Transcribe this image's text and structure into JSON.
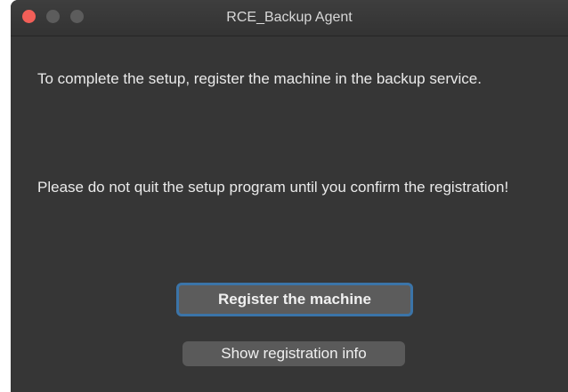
{
  "window": {
    "title": "RCE_Backup Agent"
  },
  "content": {
    "message_1": "To complete the setup, register the machine in the backup service.",
    "message_2": "Please do not quit the setup program until you confirm the registration!"
  },
  "buttons": {
    "register_label": "Register the machine",
    "show_info_label": "Show registration info"
  },
  "colors": {
    "window_bg": "#363636",
    "close_button": "#f25f58",
    "focus_ring": "#3b74a8"
  }
}
